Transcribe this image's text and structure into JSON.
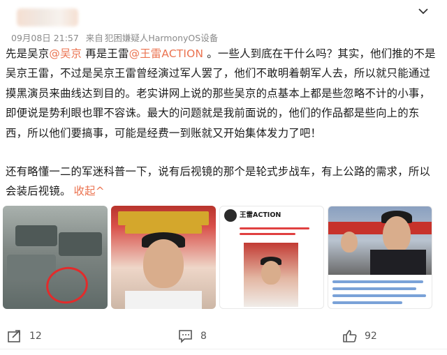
{
  "post": {
    "meta": {
      "date": "09月08日 21:57",
      "source_prefix": "来自",
      "source": "犯困嫌疑人HarmonyOS设备"
    },
    "content": {
      "p1": [
        {
          "text": "先是吴京",
          "type": "text"
        },
        {
          "text": "@吴京",
          "type": "mention"
        },
        {
          "text": " 再是王雷",
          "type": "text"
        },
        {
          "text": "@王雷ACTION",
          "type": "mention"
        },
        {
          "text": " 。一些人到底在干什么吗？其实，他们推的不是吴京王雷，不过是吴京王雷曾经演过军人罢了，他们不敢明着朝军人去，所以就只能通过摸黑演员来曲线达到目的。老实讲网上说的那些吴京的点基本上都是些忽略不计的小事，即便说是势利眼也罪不容诛。最大的问题就是我前面说的，他们的作品都是些向上的东西，所以他们要搞事，可能是经费一到账就又开始集体发力了吧！",
          "type": "text"
        }
      ],
      "p2": "还有略懂一二的军迷科普一下，说有后视镜的那个是轮式步战车，有上公路的需求，所以会装后视镜。",
      "collapse_label": "收起^"
    },
    "gallery": {
      "thumb3_name": "王雷ACTION"
    },
    "actions": {
      "repost_count": "12",
      "comment_count": "8",
      "like_count": "92"
    }
  },
  "colors": {
    "accent": "#eb7350",
    "meta": "#8a8a8a"
  },
  "icons": [
    "chevron-down-icon",
    "repost-icon",
    "comment-icon",
    "like-icon"
  ]
}
